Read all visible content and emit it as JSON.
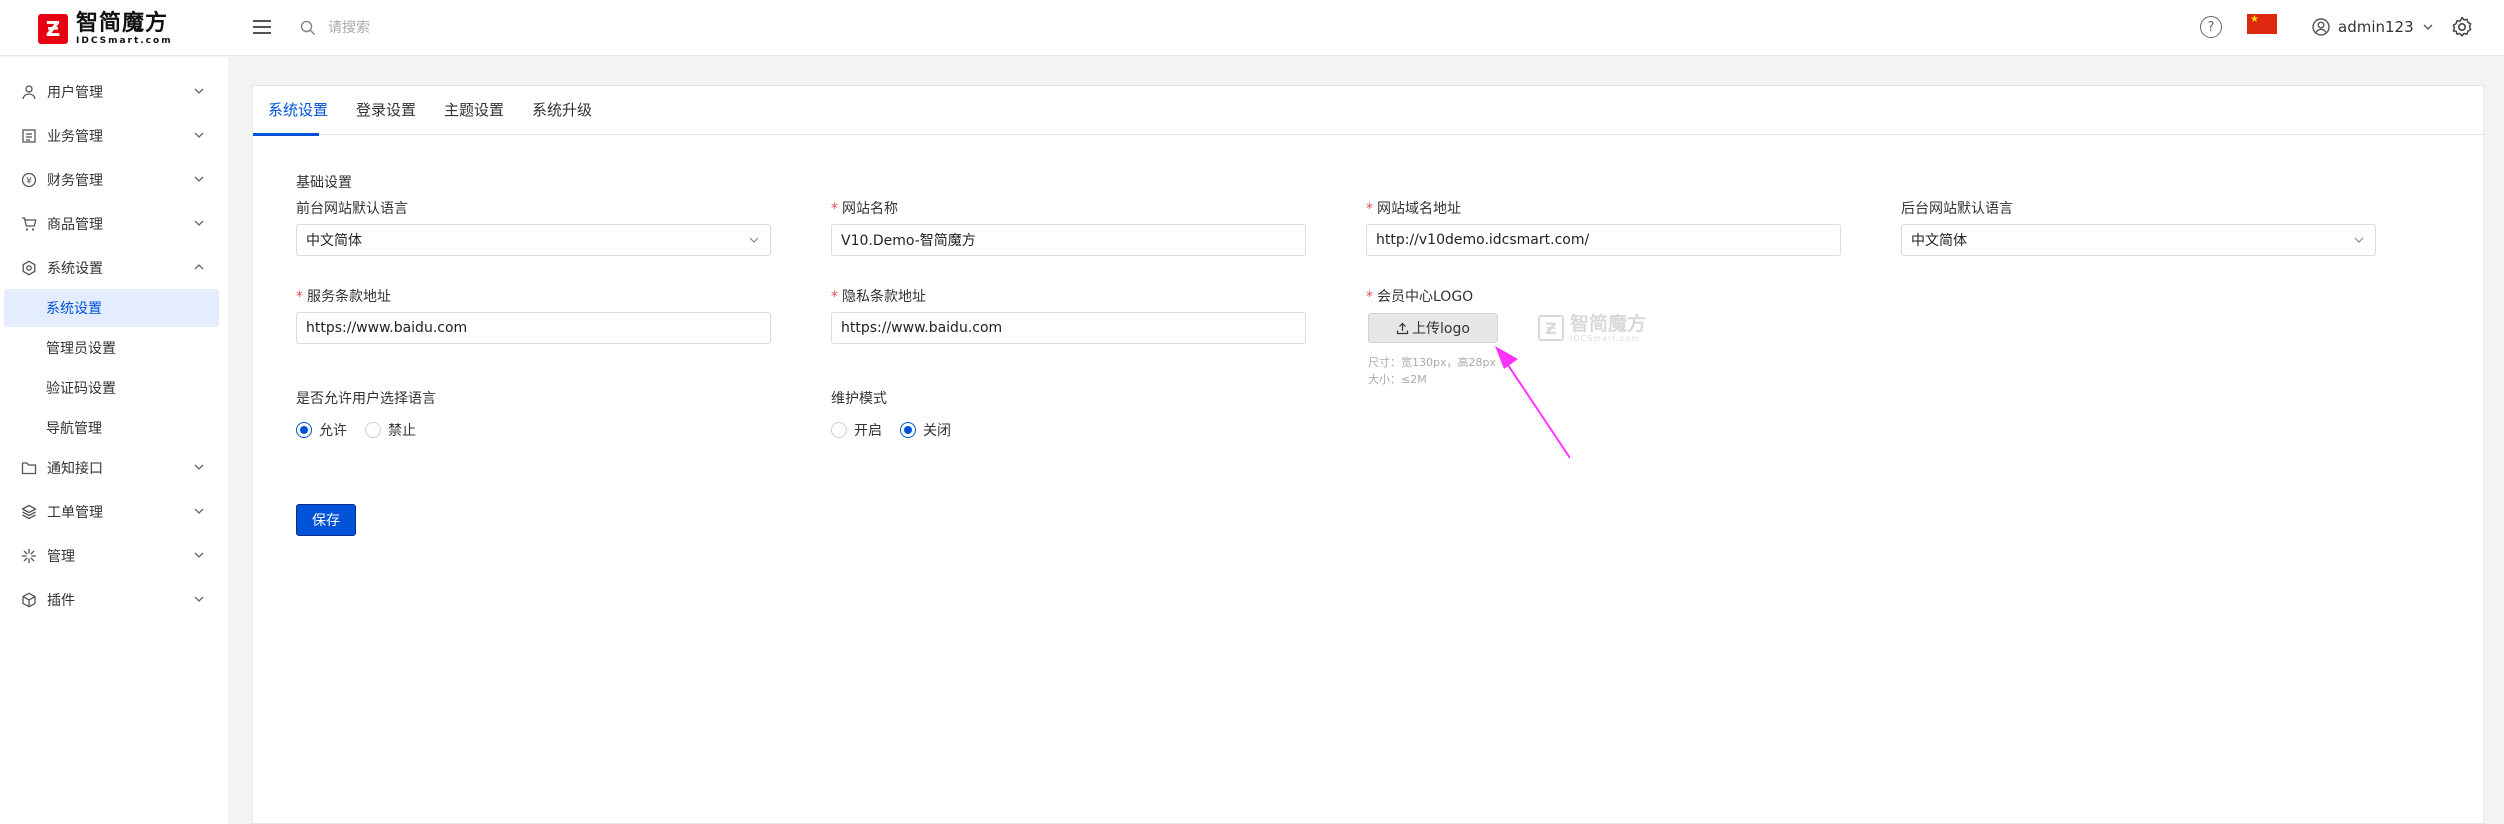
{
  "header": {
    "logo_cn": "智简魔方",
    "logo_en": "IDCSmart.com",
    "search_placeholder": "请搜索",
    "help_icon": "?",
    "username": "admin123"
  },
  "sidebar": {
    "items": [
      {
        "label": "用户管理",
        "icon": "user-icon"
      },
      {
        "label": "业务管理",
        "icon": "business-icon"
      },
      {
        "label": "财务管理",
        "icon": "finance-icon"
      },
      {
        "label": "商品管理",
        "icon": "cart-icon"
      },
      {
        "label": "系统设置",
        "icon": "settings-icon"
      },
      {
        "label": "通知接口",
        "icon": "folder-icon"
      },
      {
        "label": "工单管理",
        "icon": "layers-icon"
      },
      {
        "label": "管理",
        "icon": "asterisk-icon"
      },
      {
        "label": "插件",
        "icon": "plugin-icon"
      }
    ],
    "sub_items": [
      {
        "label": "系统设置",
        "active": true
      },
      {
        "label": "管理员设置"
      },
      {
        "label": "验证码设置"
      },
      {
        "label": "导航管理"
      }
    ]
  },
  "tabs": [
    "系统设置",
    "登录设置",
    "主题设置",
    "系统升级"
  ],
  "form": {
    "section_title": "基础设置",
    "front_lang_label": "前台网站默认语言",
    "front_lang_value": "中文简体",
    "site_name_label": "网站名称",
    "site_name_value": "V10.Demo-智简魔方",
    "site_domain_label": "网站域名地址",
    "site_domain_value": "http://v10demo.idcsmart.com/",
    "admin_lang_label": "后台网站默认语言",
    "admin_lang_value": "中文简体",
    "terms_label": "服务条款地址",
    "terms_value": "https://www.baidu.com",
    "privacy_label": "隐私条款地址",
    "privacy_value": "https://www.baidu.com",
    "logo_label": "会员中心LOGO",
    "upload_label": "上传logo",
    "logo_size_hint": "尺寸：宽130px，高28px",
    "logo_file_hint": "大小：≤2M",
    "allow_lang_label": "是否允许用户选择语言",
    "allow_lang_options": [
      "允许",
      "禁止"
    ],
    "maintenance_label": "维护模式",
    "maintenance_options": [
      "开启",
      "关闭"
    ],
    "save_label": "保存"
  },
  "colors": {
    "primary": "#0052d9",
    "required": "#e34d59",
    "annotation_arrow": "#ff33ff"
  }
}
